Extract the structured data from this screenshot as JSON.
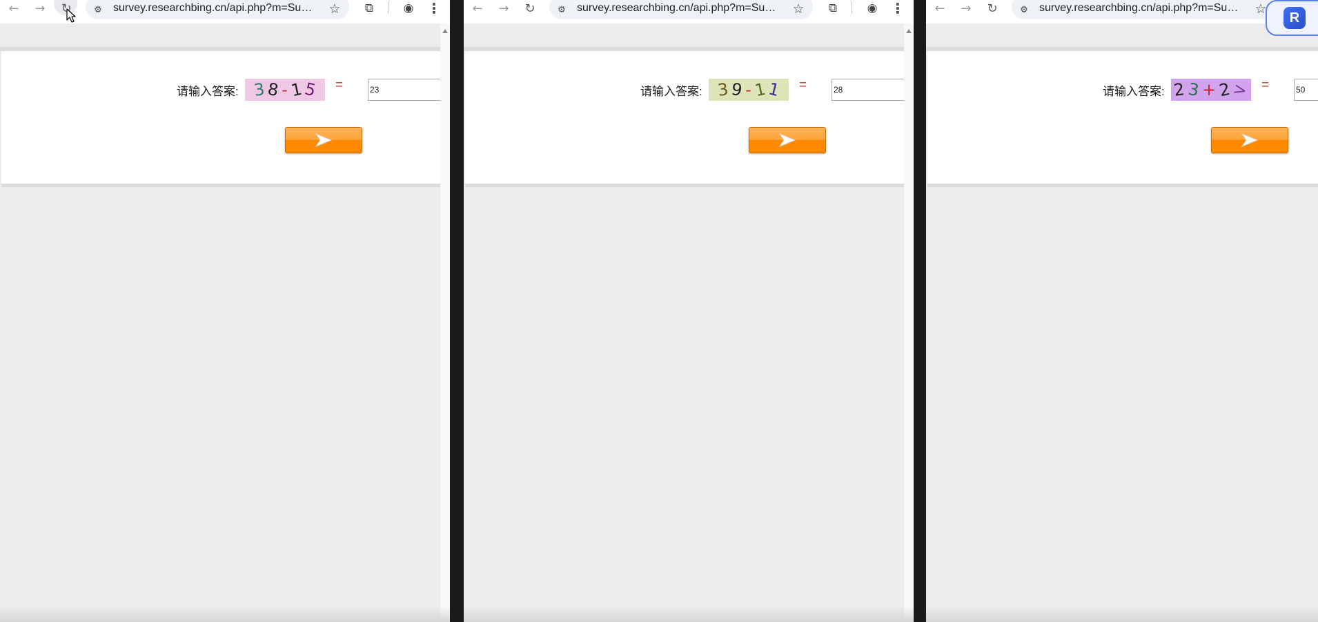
{
  "windows": [
    {
      "url": "survey.researchbing.cn/api.php?m=Surv...",
      "prompt_label": "请输入答案:",
      "captcha": {
        "background": "#efc8e6",
        "chars": [
          {
            "text": "3",
            "color": "#2e7d6b"
          },
          {
            "text": "8",
            "color": "#1f1f1f"
          },
          {
            "text": "-",
            "color": "#c0392b"
          },
          {
            "text": "1",
            "color": "#1f1f1f"
          },
          {
            "text": "5",
            "color": "#6a1b6e"
          }
        ]
      },
      "equals": "=",
      "answer_value": "23"
    },
    {
      "url": "survey.researchbing.cn/api.php?m=Surv...",
      "prompt_label": "请输入答案:",
      "captcha": {
        "background": "#dfe3b8",
        "chars": [
          {
            "text": "3",
            "color": "#6b5a1f"
          },
          {
            "text": "9",
            "color": "#1f1f1f"
          },
          {
            "text": "-",
            "color": "#c0392b"
          },
          {
            "text": "1",
            "color": "#4b6b1f"
          },
          {
            "text": "1",
            "color": "#3a2a8a"
          }
        ]
      },
      "equals": "=",
      "answer_value": "28"
    },
    {
      "url": "survey.researchbing.cn/api.php?m=Surv...",
      "prompt_label": "请输入答案:",
      "captcha": {
        "background": "#d3a4ee",
        "chars": [
          {
            "text": "2",
            "color": "#1f1f1f"
          },
          {
            "text": "3",
            "color": "#2e6b4f"
          },
          {
            "text": "+",
            "color": "#d0202a"
          },
          {
            "text": "2",
            "color": "#1f1f1f"
          },
          {
            "text": ">",
            "color": "#7a3a9a"
          }
        ]
      },
      "equals": "=",
      "answer_value": "50"
    }
  ],
  "icons": {
    "back": "←",
    "forward": "→",
    "reload": "↻",
    "site_settings": "⚙",
    "star": "☆",
    "extensions": "⧉",
    "profile": "◉",
    "menu": "⋮"
  },
  "assistant_badge": {
    "letter": "R"
  }
}
